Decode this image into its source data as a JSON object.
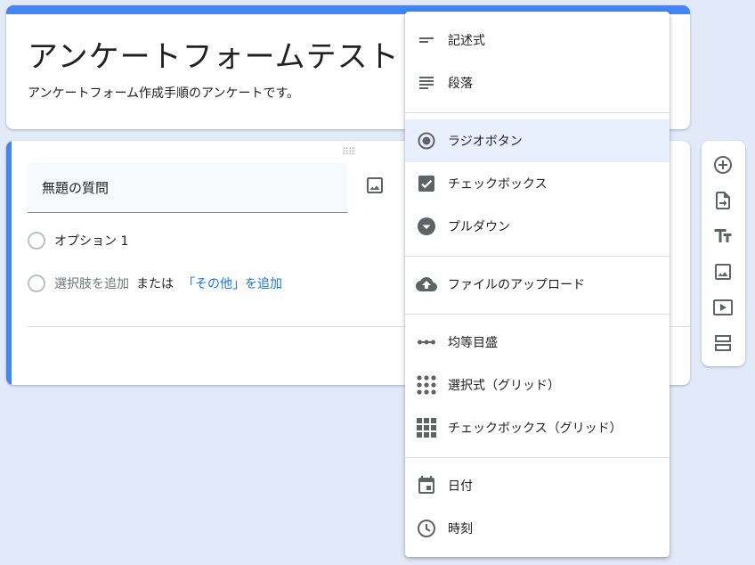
{
  "form": {
    "title": "アンケートフォームテスト",
    "description": "アンケートフォーム作成手順のアンケートです。"
  },
  "question": {
    "title": "無題の質問",
    "option1": "オプション 1",
    "add_option": "選択肢を追加",
    "or_text": "または",
    "add_other": "「その他」を追加"
  },
  "menu": {
    "items": [
      {
        "label": "記述式",
        "icon": "short-answer-icon"
      },
      {
        "label": "段落",
        "icon": "paragraph-icon"
      },
      {
        "label": "ラジオボタン",
        "icon": "radio-button-icon",
        "selected": true
      },
      {
        "label": "チェックボックス",
        "icon": "checkbox-icon"
      },
      {
        "label": "プルダウン",
        "icon": "dropdown-icon"
      },
      {
        "label": "ファイルのアップロード",
        "icon": "cloud-upload-icon"
      },
      {
        "label": "均等目盛",
        "icon": "linear-scale-icon"
      },
      {
        "label": "選択式（グリッド）",
        "icon": "multiple-choice-grid-icon"
      },
      {
        "label": "チェックボックス（グリッド）",
        "icon": "checkbox-grid-icon"
      },
      {
        "label": "日付",
        "icon": "calendar-icon"
      },
      {
        "label": "時刻",
        "icon": "clock-icon"
      }
    ]
  },
  "toolbar": {
    "icons": [
      "add-question-icon",
      "import-question-icon",
      "add-title-icon",
      "add-image-icon",
      "add-video-icon",
      "add-section-icon"
    ]
  },
  "colors": {
    "accent": "#4285f4",
    "link": "#1a73e8",
    "selected_bg": "#e8f0fe",
    "page_bg": "#e2eafa"
  }
}
